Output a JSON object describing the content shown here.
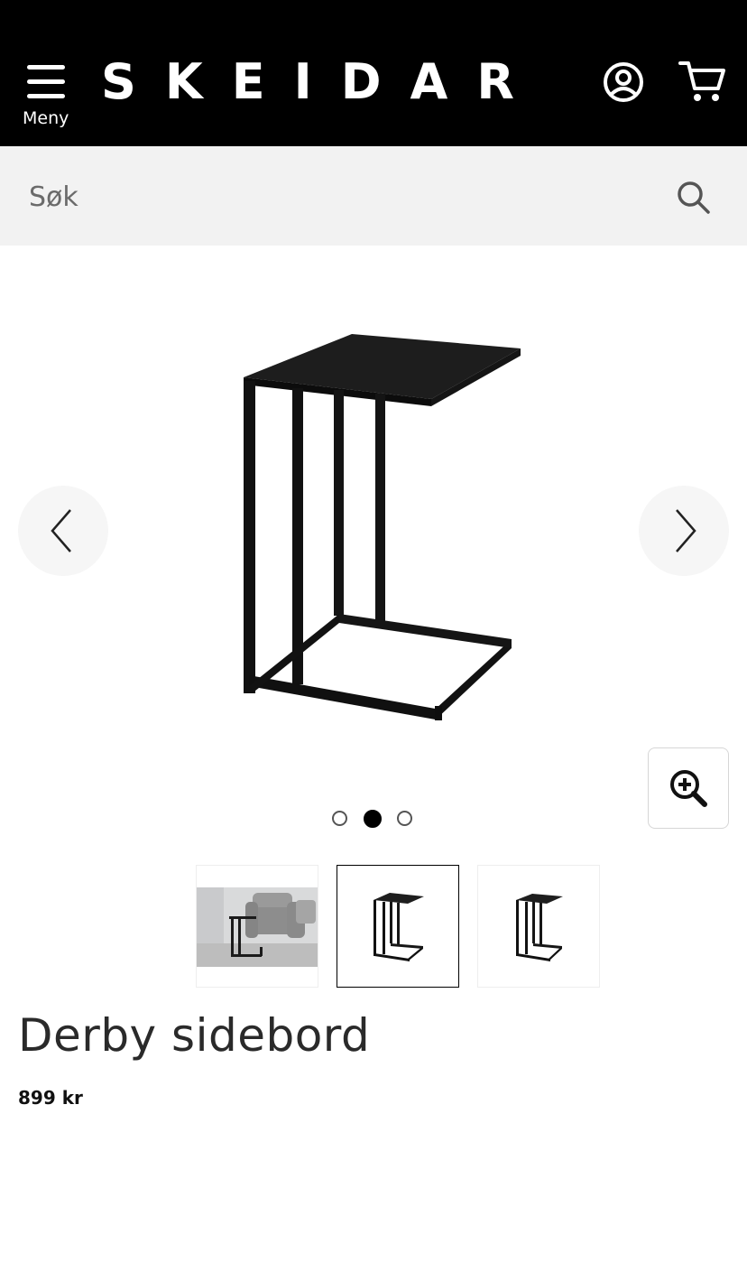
{
  "header": {
    "menu_label": "Meny",
    "logo_text": "SKEIDAR",
    "icons": [
      "hamburger-menu-icon",
      "account-icon",
      "cart-icon"
    ],
    "background_color": "#000000"
  },
  "search": {
    "placeholder": "Søk",
    "icon": "search-icon"
  },
  "carousel": {
    "slide_count": 3,
    "active_slide": 2,
    "icons": [
      "chevron-left-icon",
      "chevron-right-icon",
      "zoom-in-icon"
    ]
  },
  "thumbnails": [
    {
      "subject": "side table in living room beside grey armchair",
      "selected": false
    },
    {
      "subject": "black metal C-shaped side table",
      "selected": true
    },
    {
      "subject": "black metal C-shaped side table",
      "selected": false
    }
  ],
  "product": {
    "title": "Derby sidebord",
    "price": "899 kr"
  }
}
